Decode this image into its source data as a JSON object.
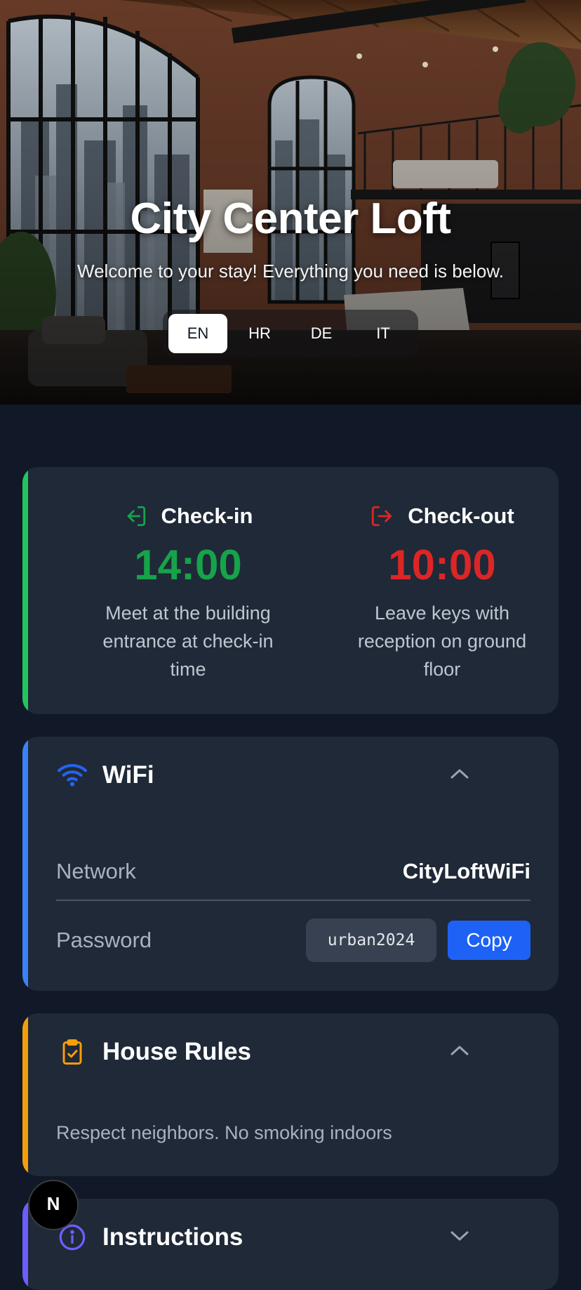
{
  "hero": {
    "title": "City Center Loft",
    "subtitle": "Welcome to your stay! Everything you need is below."
  },
  "languages": {
    "items": [
      "EN",
      "HR",
      "DE",
      "IT"
    ],
    "selected": "EN"
  },
  "times": {
    "checkin": {
      "label": "Check-in",
      "time": "14:00",
      "description": "Meet at the building entrance at check-in time",
      "icon": "login-icon",
      "color": "#16a34a"
    },
    "checkout": {
      "label": "Check-out",
      "time": "10:00",
      "description": "Leave keys with reception on ground floor",
      "icon": "logout-icon",
      "color": "#dc2626"
    },
    "accent": "#22c55e"
  },
  "wifi": {
    "title": "WiFi",
    "icon": "wifi-icon",
    "expanded": true,
    "accent": "#3b82f6",
    "network_label": "Network",
    "network_value": "CityLoftWiFi",
    "password_label": "Password",
    "password_value": "urban2024",
    "copy_label": "Copy"
  },
  "house_rules": {
    "title": "House Rules",
    "icon": "clipboard-check-icon",
    "expanded": true,
    "accent": "#f59e0b",
    "text": "Respect neighbors. No smoking indoors"
  },
  "instructions": {
    "title": "Instructions",
    "icon": "info-icon",
    "expanded": false,
    "accent": "#6d5dfc"
  },
  "fab": {
    "label": "N",
    "icon": "nextjs-logo-icon"
  }
}
